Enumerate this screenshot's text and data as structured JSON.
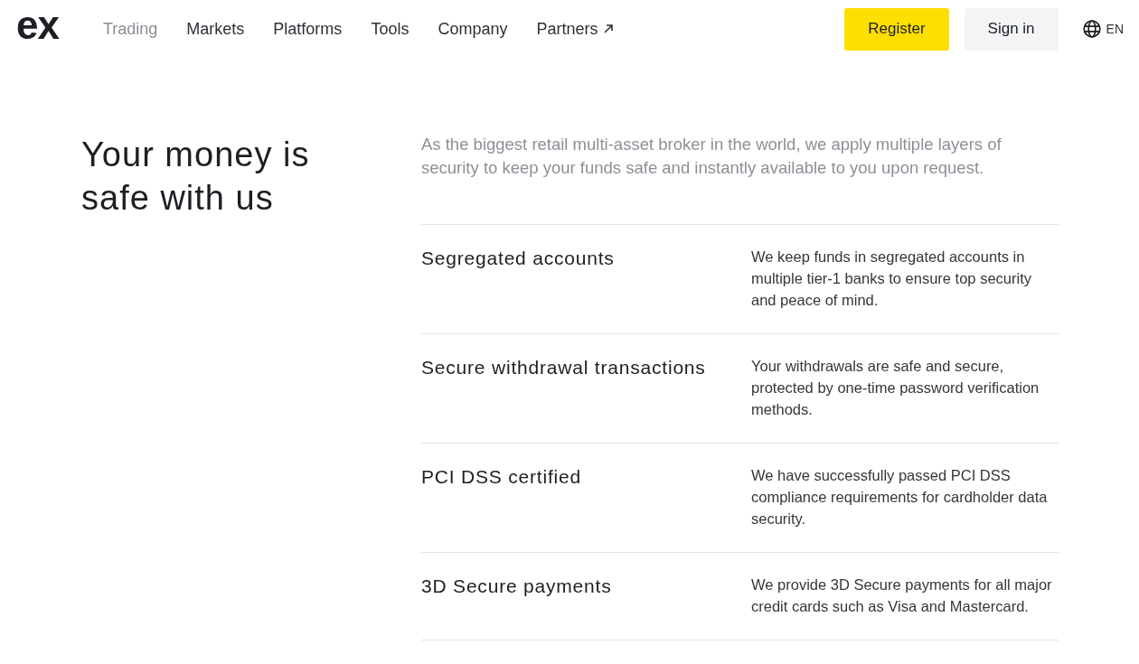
{
  "header": {
    "logo": "ex",
    "nav": [
      {
        "label": "Trading",
        "selected": true,
        "external": false
      },
      {
        "label": "Markets",
        "selected": false,
        "external": false
      },
      {
        "label": "Platforms",
        "selected": false,
        "external": false
      },
      {
        "label": "Tools",
        "selected": false,
        "external": false
      },
      {
        "label": "Company",
        "selected": false,
        "external": false
      },
      {
        "label": "Partners",
        "selected": false,
        "external": true
      }
    ],
    "buttons": [
      {
        "label": "Register",
        "kind": "primary"
      },
      {
        "label": "Sign in",
        "kind": "secondary"
      }
    ],
    "language": "EN"
  },
  "section": {
    "heading": "Your money is safe with us",
    "intro": "As the biggest retail multi-asset broker in the world, we apply multiple layers of security to keep your funds safe and instantly available to you upon request.",
    "features": [
      {
        "title": "Segregated accounts",
        "description": "We keep funds in segregated accounts in multiple tier-1 banks to ensure top security and peace of mind."
      },
      {
        "title": "Secure withdrawal transactions",
        "description": "Your withdrawals are safe and secure, protected by one-time password verification methods."
      },
      {
        "title": "PCI DSS certified",
        "description": "We have successfully passed PCI DSS compliance requirements for cardholder data security."
      },
      {
        "title": "3D Secure payments",
        "description": "We provide 3D Secure payments for all major credit cards such as Visa and Mastercard."
      }
    ]
  }
}
